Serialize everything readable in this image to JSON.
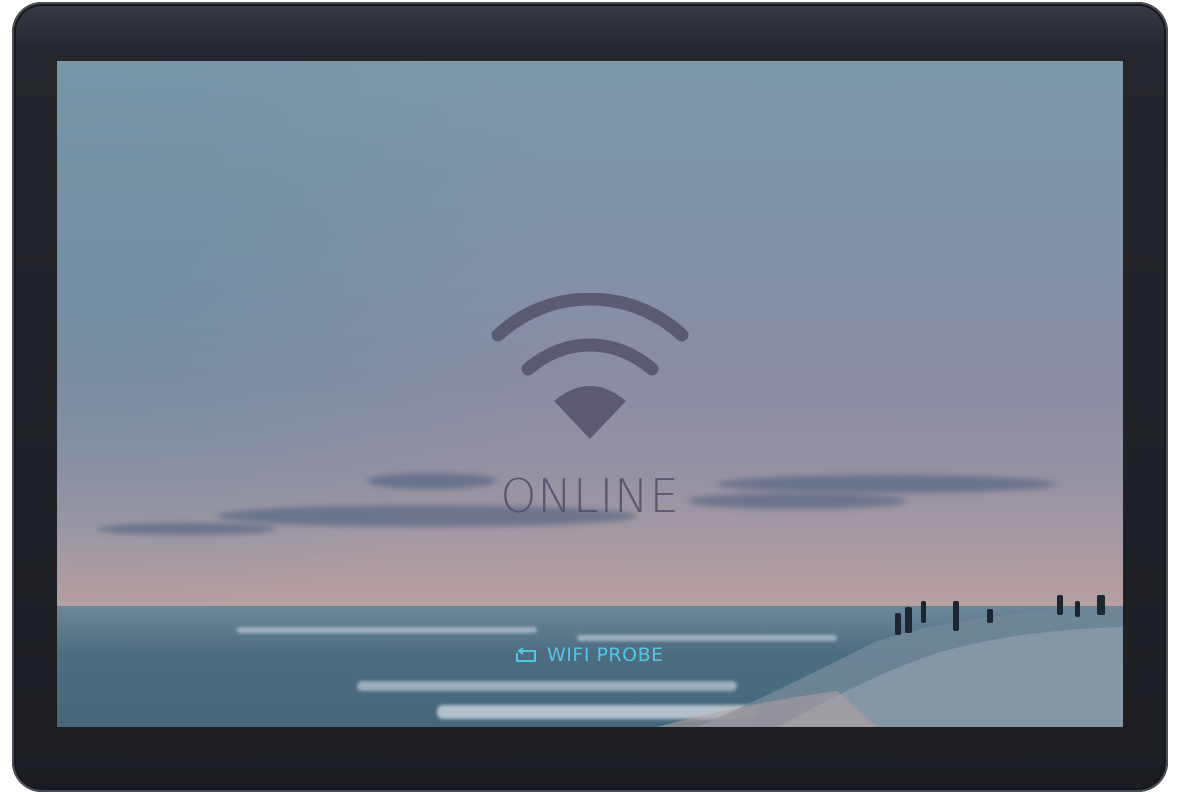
{
  "status": {
    "label": "ONLINE",
    "icon": "wifi-icon",
    "color": "#504e66"
  },
  "probe_button": {
    "label": "WIFI PROBE",
    "icon": "refresh-icon",
    "color": "#52c6e6"
  },
  "background": {
    "description_icon": "beach-sunset-wallpaper"
  }
}
